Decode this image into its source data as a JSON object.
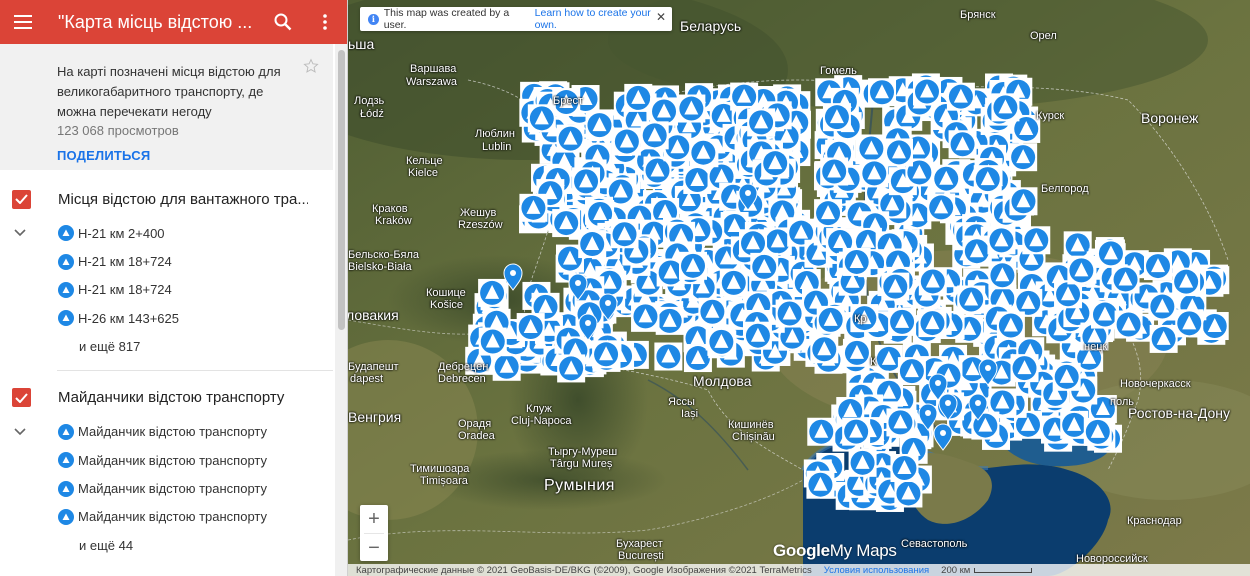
{
  "header": {
    "title": "\"Карта місць відстою ..."
  },
  "description": {
    "text": "На карті позначені місця відстою для великогабаритного транспорту, де можна перечекати негоду",
    "views": "123 068 просмотров",
    "share": "ПОДЕЛИТЬСЯ"
  },
  "layers": [
    {
      "title": "Місця відстою для вантажного тра...",
      "items": [
        "Н-21 км 2+400",
        "Н-21 км 18+724",
        "Н-21 км 18+724",
        "Н-26 км 143+625"
      ],
      "more": "и ещё 817"
    },
    {
      "title": "Майданчики відстою транспорту",
      "items": [
        "Майданчик відстою транспорту",
        "Майданчик відстою транспорту",
        "Майданчик відстою транспорту",
        "Майданчик відстою транспорту"
      ],
      "more": "и ещё 44"
    }
  ],
  "notice": {
    "text": "This map was created by a user.",
    "link": "Learn how to create your own."
  },
  "map_labels": {
    "belarus": "Беларусь",
    "bryansk": "Брянск",
    "orel": "Орел",
    "gomel": "Гомель",
    "varshava": "Варшава",
    "warszawa": "Warszawa",
    "brest": "Брест",
    "lodz": "Лодзь",
    "lodz_pl": "Łódź",
    "lublin": "Люблин",
    "lublin_pl": "Lublin",
    "kurchatov": "Курск",
    "voronezh": "Воронеж",
    "kielce": "Кельце",
    "kielce_pl": "Kielce",
    "belgorod": "Белгород",
    "krakow": "Краков",
    "krakow_pl": "Kraków",
    "zheshuv": "Жешув",
    "rzeszow": "Rzeszów",
    "bielsko": "Бельско-Бяла",
    "bielsko_pl": "Bielsko-Biała",
    "koshice": "Кошице",
    "kosice": "Košice",
    "slovakia": "ловакия",
    "debrecen": "Дебрецен",
    "debrecen_hu": "Debrecen",
    "budapest": "Будапешт",
    "budapest_hu": "dapest",
    "hungary": "Венгрия",
    "moldova": "Молдова",
    "iasi": "Яссы",
    "iasi_ro": "Iași",
    "chisinau": "Кишинёв",
    "chisinau_md": "Chișinău",
    "cluj": "Клуж",
    "cluj_ro": "Cluj-Napoca",
    "oradea": "Орадя",
    "oradea_ro": "Oradea",
    "mures": "Тыргу-Муреш",
    "mures_ro": "Târgu Mureș",
    "timisoara": "Тимишоара",
    "timisoara_ro": "Timișoara",
    "romania": "Румыния",
    "bucharest": "Бухарест",
    "bucuresti": "București",
    "donetsk": "нецк",
    "novocherkassk": "Новочеркасск",
    "rostov": "Ростов-на-Дону",
    "krasnodar": "Краснодар",
    "sevastopol": "Севастополь",
    "novorossiysk": "Новороссийск",
    "pol": "поль",
    "kr": "Кр",
    "k": "К",
    "sha": "ьша"
  },
  "logo": {
    "google": "Google",
    "mymaps": "My Maps"
  },
  "attribution": {
    "text": "Картографические данные © 2021 GeoBasis-DE/BKG (©2009), Google Изображения ©2021 TerraMetrics",
    "terms": "Условия использования",
    "scale": "200 км"
  },
  "zoom": {
    "in": "+",
    "out": "−"
  },
  "colors": {
    "header": "#db4437",
    "marker": "#1e88e5",
    "link": "#1a73e8",
    "sea": "#0b3d6e"
  }
}
